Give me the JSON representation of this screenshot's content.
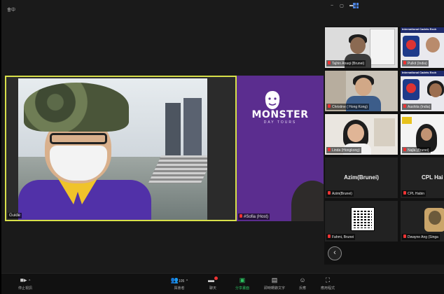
{
  "window": {
    "info_label": "會中",
    "controls": [
      "‒",
      "▢",
      "▬"
    ]
  },
  "active_speaker": {
    "name": "Guide"
  },
  "share": {
    "brand_title": "MONSTER",
    "brand_subtitle": "DAY TOURS",
    "name": "#Sofia (Host)"
  },
  "gallery": {
    "tiles": [
      {
        "name": "Tajhin Anaqi (Brunei)",
        "banner": ""
      },
      {
        "name": "Pulkit (India)",
        "banner": "International Cadets Exch"
      },
      {
        "name": "Christine ( Hong Kong)",
        "banner": ""
      },
      {
        "name": "Aashita (India)",
        "banner": "International Cadets Exch"
      },
      {
        "name": "Linda (Hongkong)",
        "banner": ""
      },
      {
        "name": "Najla (Brunei)",
        "banner": ""
      },
      {
        "name": "Azim(Brunei)",
        "big": "Azim(Brunei)"
      },
      {
        "name": "CPL Habin",
        "big": "CPL Hai"
      },
      {
        "name": "Fahmi, Brunei",
        "big": ""
      },
      {
        "name": "Dwayne Ang (Singa",
        "big": ""
      }
    ]
  },
  "toolbar": {
    "stop_video": "停止視訊",
    "participants": "與會者",
    "participants_count": "105",
    "chat": "聊天",
    "share_screen": "分享畫面",
    "captions": "即時轉錄文字",
    "reactions": "反應",
    "view": "應用程式"
  },
  "colors": {
    "active_border": "#d8e04a",
    "share_bg": "#5b2d8f",
    "share_green": "#2dc261",
    "muted_red": "#ee3333"
  }
}
